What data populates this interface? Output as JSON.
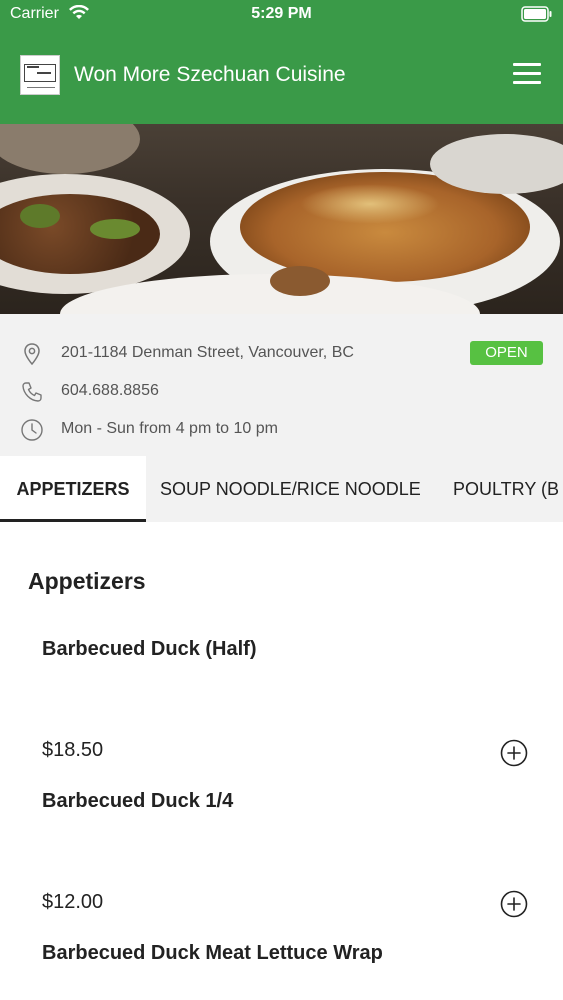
{
  "status_bar": {
    "carrier": "Carrier",
    "time": "5:29 PM",
    "icons": [
      "wifi-icon",
      "battery-icon"
    ]
  },
  "header": {
    "title": "Won More Szechuan Cuisine",
    "menu_icon": "hamburger-menu-icon",
    "background_color": "#3a9a48"
  },
  "info": {
    "address": "201-1184 Denman Street, Vancouver, BC",
    "phone": "604.688.8856",
    "hours": "Mon - Sun from 4 pm to 10 pm",
    "status_badge": "OPEN",
    "status_color": "#57c142",
    "icons": [
      "location-pin-icon",
      "phone-icon",
      "clock-icon"
    ]
  },
  "tabs": [
    {
      "label": "APPETIZERS",
      "active": true
    },
    {
      "label": "SOUP NOODLE/RICE NOODLE",
      "active": false
    },
    {
      "label": "POULTRY (B",
      "active": false
    }
  ],
  "menu": {
    "section_title": "Appetizers",
    "items": [
      {
        "name": "Barbecued Duck (Half)",
        "price": "$18.50"
      },
      {
        "name": "Barbecued Duck 1/4",
        "price": "$12.00"
      },
      {
        "name": "Barbecued Duck Meat Lettuce Wrap",
        "price": ""
      }
    ],
    "add_icon": "plus-circle-icon"
  }
}
